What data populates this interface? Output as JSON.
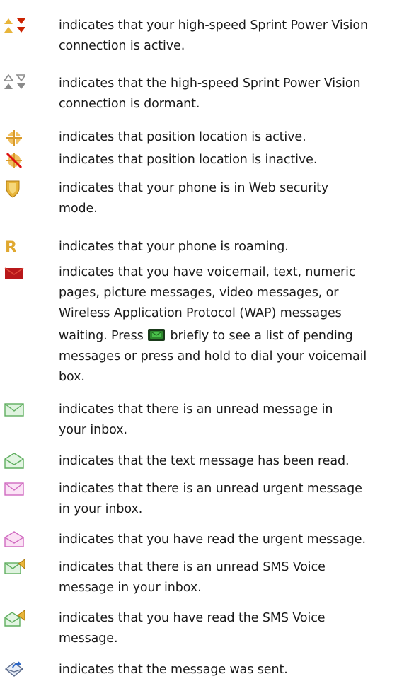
{
  "icons": {
    "row1": "power-vision-active-icon",
    "row2": "power-vision-dormant-icon",
    "row3": "position-location-active-icon",
    "row4": "position-location-inactive-icon",
    "row5": "web-security-shield-icon",
    "row6": "roaming-r-icon",
    "row7": "voicemail-envelope-icon",
    "row8": "unread-message-envelope-icon",
    "row9": "read-text-message-icon",
    "row10": "unread-urgent-message-icon",
    "row11": "read-urgent-message-icon",
    "row12": "unread-sms-voice-icon",
    "row13": "read-sms-voice-icon",
    "row14": "message-sent-icon",
    "inline_key": "messaging-key-icon"
  },
  "colors": {
    "text": "#1a1a1a",
    "red": "#cc2200",
    "gold": "#e8b53a",
    "green_envelope": "#9ed69e",
    "pink_envelope": "#e88ad8"
  },
  "rows": [
    {
      "lines": [
        "indicates that your high-speed Sprint Power Vision",
        "connection is active."
      ]
    },
    {
      "lines": [
        "indicates that the high-speed Sprint Power Vision",
        "connection is dormant."
      ]
    },
    {
      "lines": [
        "indicates that position location is active."
      ]
    },
    {
      "lines": [
        "indicates that position location is inactive."
      ]
    },
    {
      "lines": [
        "indicates that your phone is in Web security",
        "mode."
      ]
    },
    {
      "lines": [
        "indicates that your phone is roaming."
      ]
    },
    {
      "lines": [
        "indicates that you have voicemail, text, numeric",
        "pages, picture messages, video messages, or",
        "Wireless Application Protocol (WAP) messages"
      ],
      "press_before": "waiting. Press",
      "press_after": "briefly to see a list of pending",
      "tail_lines": [
        "messages or press and hold to dial your voicemail",
        "box."
      ]
    },
    {
      "lines": [
        "indicates that there is an unread message in",
        "your inbox."
      ]
    },
    {
      "lines": [
        "indicates that the text message has been read."
      ]
    },
    {
      "lines": [
        "indicates that there is an unread urgent message",
        "in your inbox."
      ]
    },
    {
      "lines": [
        "indicates that you have read the urgent message."
      ]
    },
    {
      "lines": [
        "indicates that there is an unread SMS Voice",
        "message in your inbox."
      ]
    },
    {
      "lines": [
        "indicates that you have read the SMS Voice",
        "message."
      ]
    },
    {
      "lines": [
        "indicates that the message was sent."
      ]
    }
  ]
}
